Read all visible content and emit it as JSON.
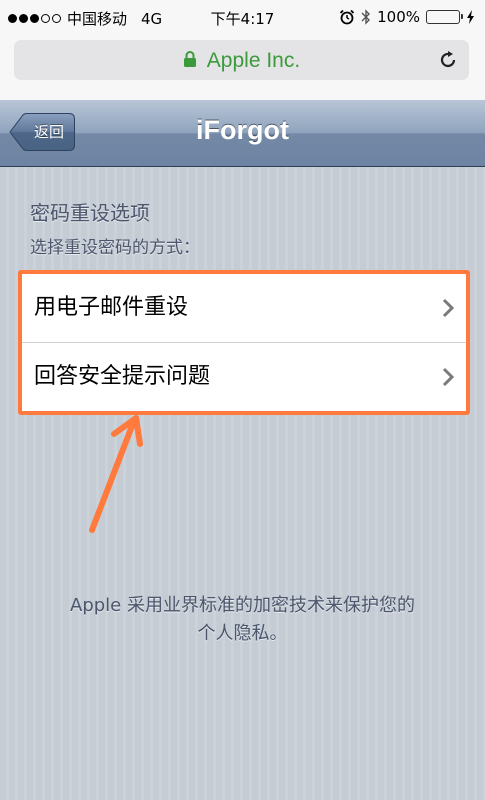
{
  "status_bar": {
    "carrier": "中国移动",
    "network": "4G",
    "time": "下午4:17",
    "battery_percent": "100%",
    "battery_level": 1.0
  },
  "browser": {
    "site_title": "Apple Inc.",
    "secure": true,
    "accent_color": "#3c9a3c"
  },
  "navbar": {
    "back_label": "返回",
    "title": "iForgot"
  },
  "content": {
    "section_title": "密码重设选项",
    "section_subtitle": "选择重设密码的方式：",
    "options": [
      {
        "label": "用电子邮件重设"
      },
      {
        "label": "回答安全提示问题"
      }
    ],
    "footer_line1": "Apple 采用业界标准的加密技术来保护您的",
    "footer_line2": "个人隐私。"
  },
  "annotation": {
    "highlight_color": "#ff7a3c"
  }
}
